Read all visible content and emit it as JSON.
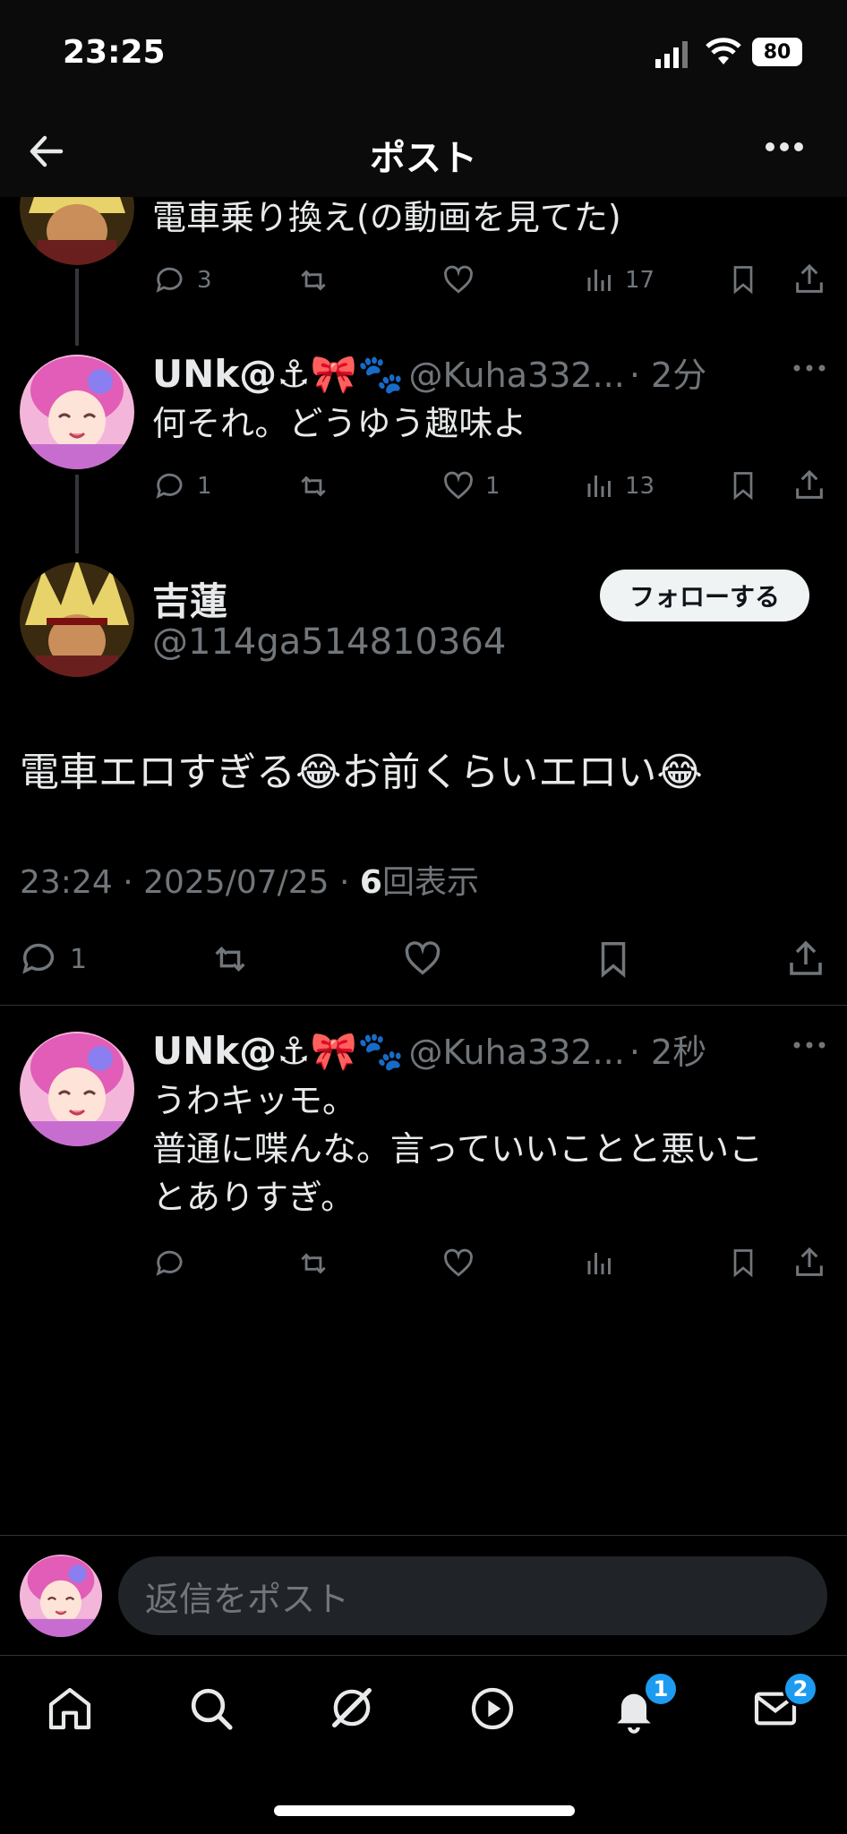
{
  "status_bar": {
    "time": "23:25",
    "battery": "80"
  },
  "header": {
    "title": "ポスト"
  },
  "prev_post": {
    "text": "電車乗り換え(の動画を見てた)",
    "replies": "3",
    "reposts": "",
    "likes": "",
    "views": "17"
  },
  "reply_1": {
    "name": "UNk@⚓🎀🐾",
    "handle": "@Kuha332...",
    "time": "· 2分",
    "text": "何それ。どうゆう趣味よ",
    "replies": "1",
    "likes": "1",
    "views": "13"
  },
  "main_post": {
    "name": "吉蓮",
    "handle": "@114ga514810364",
    "follow_label": "フォローする",
    "text": "電車エロすぎる😂お前くらいエロい😂",
    "timestamp": "23:24 · 2025/07/25 · ",
    "views_count": "6",
    "views_label": "回表示",
    "replies": "1"
  },
  "reply_2": {
    "name": "UNk@⚓🎀🐾",
    "handle": "@Kuha332...",
    "time": "· 2秒",
    "line1": "うわキッモ。",
    "line2": "普通に喋んな。言っていいことと悪いこ",
    "line3": "とありすぎ。"
  },
  "composer": {
    "placeholder": "返信をポスト"
  },
  "bottom_nav": {
    "notifications_badge": "1",
    "messages_badge": "2"
  },
  "colors": {
    "accent": "#1d9bf0",
    "background": "#000000",
    "muted": "#71767b"
  }
}
